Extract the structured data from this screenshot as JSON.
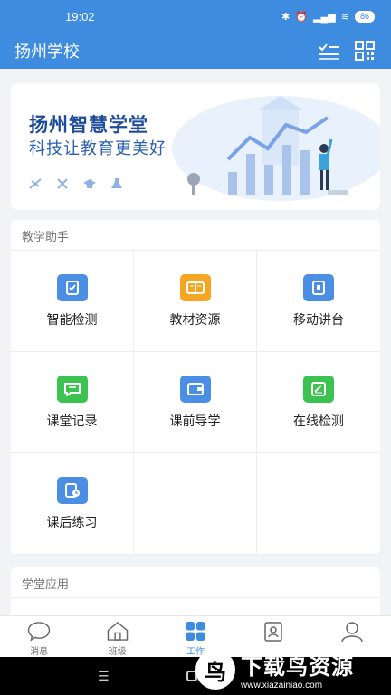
{
  "status_bar": {
    "time": "19:02",
    "battery": "86"
  },
  "header": {
    "title": "扬州学校"
  },
  "banner": {
    "title": "扬州智慧学堂",
    "slogan": "科技让教育更美好"
  },
  "teaching": {
    "section_title": "教学助手",
    "items": [
      {
        "label": "智能检测",
        "color": "#4a8fe3",
        "icon": "clipboard-icon"
      },
      {
        "label": "教材资源",
        "color": "#f5a623",
        "icon": "book-icon"
      },
      {
        "label": "移动讲台",
        "color": "#4a8fe3",
        "icon": "mobile-podium-icon"
      },
      {
        "label": "课堂记录",
        "color": "#3cc24f",
        "icon": "chat-record-icon"
      },
      {
        "label": "课前导学",
        "color": "#4a8fe3",
        "icon": "wallet-icon"
      },
      {
        "label": "在线检测",
        "color": "#3cc24f",
        "icon": "edit-check-icon"
      },
      {
        "label": "课后练习",
        "color": "#4a8fe3",
        "icon": "homework-clock-icon"
      }
    ]
  },
  "apps": {
    "section_title": "学堂应用"
  },
  "bottom_nav": {
    "items": [
      {
        "label": "消息",
        "icon": "chat-bubble-icon",
        "active": false
      },
      {
        "label": "班级",
        "icon": "house-icon",
        "active": false
      },
      {
        "label": "工作",
        "icon": "grid-icon",
        "active": true
      },
      {
        "label": "",
        "icon": "contacts-icon",
        "active": false
      },
      {
        "label": "",
        "icon": "person-icon",
        "active": false
      }
    ]
  },
  "watermark": {
    "title": "下载鸟资源",
    "url": "www.xiazainiao.com"
  }
}
